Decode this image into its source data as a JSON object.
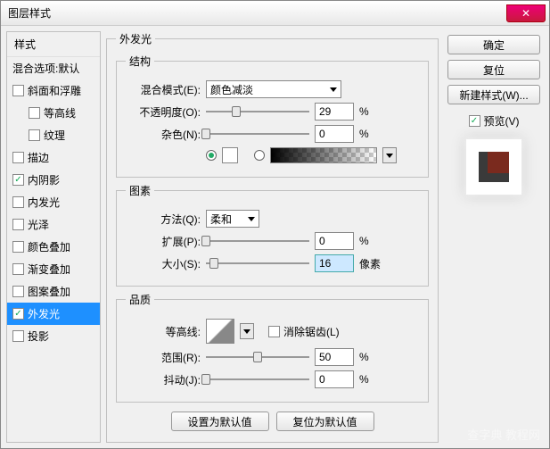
{
  "window": {
    "title": "图层样式",
    "close_glyph": "✕"
  },
  "sidebar": {
    "header": "样式",
    "blending": "混合选项:默认",
    "items": [
      {
        "label": "斜面和浮雕",
        "checked": false,
        "indent": false
      },
      {
        "label": "等高线",
        "checked": false,
        "indent": true
      },
      {
        "label": "纹理",
        "checked": false,
        "indent": true
      },
      {
        "label": "描边",
        "checked": false,
        "indent": false
      },
      {
        "label": "内阴影",
        "checked": true,
        "indent": false
      },
      {
        "label": "内发光",
        "checked": false,
        "indent": false
      },
      {
        "label": "光泽",
        "checked": false,
        "indent": false
      },
      {
        "label": "颜色叠加",
        "checked": false,
        "indent": false
      },
      {
        "label": "渐变叠加",
        "checked": false,
        "indent": false
      },
      {
        "label": "图案叠加",
        "checked": false,
        "indent": false
      },
      {
        "label": "外发光",
        "checked": true,
        "indent": false,
        "selected": true
      },
      {
        "label": "投影",
        "checked": false,
        "indent": false
      }
    ]
  },
  "panel": {
    "title": "外发光",
    "structure": {
      "legend": "结构",
      "blend_label": "混合模式(E):",
      "blend_value": "颜色减淡",
      "opacity_label": "不透明度(O):",
      "opacity_value": "29",
      "opacity_unit": "%",
      "noise_label": "杂色(N):",
      "noise_value": "0",
      "noise_unit": "%"
    },
    "elements": {
      "legend": "图素",
      "method_label": "方法(Q):",
      "method_value": "柔和",
      "spread_label": "扩展(P):",
      "spread_value": "0",
      "spread_unit": "%",
      "size_label": "大小(S):",
      "size_value": "16",
      "size_unit": "像素"
    },
    "quality": {
      "legend": "品质",
      "contour_label": "等高线:",
      "antialias_label": "消除锯齿(L)",
      "range_label": "范围(R):",
      "range_value": "50",
      "range_unit": "%",
      "jitter_label": "抖动(J):",
      "jitter_value": "0",
      "jitter_unit": "%"
    },
    "buttons": {
      "default": "设置为默认值",
      "reset": "复位为默认值"
    }
  },
  "right": {
    "ok": "确定",
    "cancel": "复位",
    "newstyle": "新建样式(W)...",
    "preview_label": "预览(V)"
  },
  "watermark": "查字典 教程网"
}
